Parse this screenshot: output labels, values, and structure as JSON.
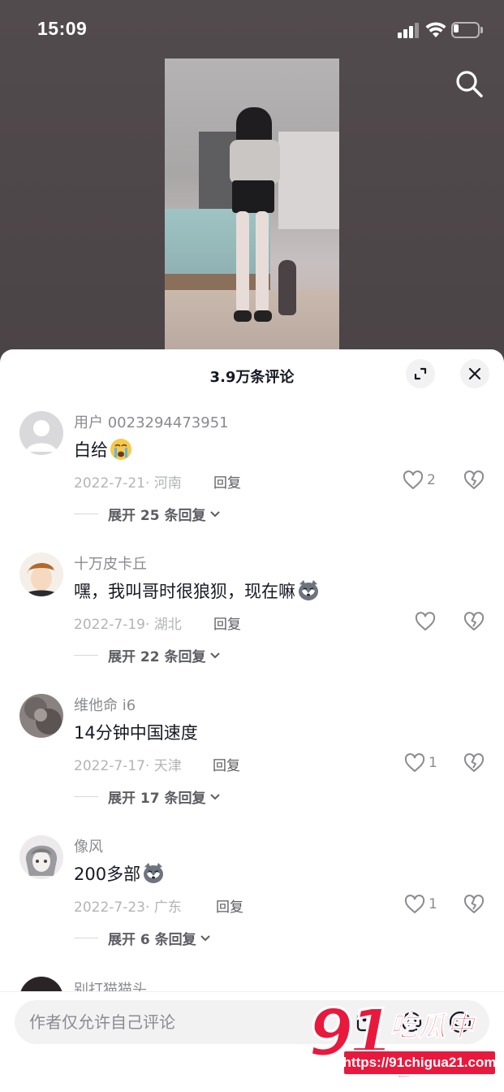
{
  "status_bar": {
    "time": "15:09",
    "battery_level": 0.2
  },
  "sheet": {
    "title": "3.9万条评论"
  },
  "comments": [
    {
      "user": "用户 0023294473951",
      "text": "白给",
      "emoji": "crying-face-emoji",
      "date": "2022-7-21· 河南",
      "reply": "回复",
      "likes": "2",
      "expand": "展开 25 条回复"
    },
    {
      "user": "十万皮卡丘",
      "text": "嘿，我叫哥时很狼狈，现在嘛",
      "emoji": "husky-emoji",
      "date": "2022-7-19· 湖北",
      "reply": "回复",
      "likes": "",
      "expand": "展开 22 条回复"
    },
    {
      "user": "维他命 i6",
      "text": "14分钟中国速度",
      "emoji": "",
      "date": "2022-7-17· 天津",
      "reply": "回复",
      "likes": "1",
      "expand": "展开 17 条回复"
    },
    {
      "user": "像风",
      "text": "200多部",
      "emoji": "husky-emoji",
      "date": "2022-7-23· 广东",
      "reply": "回复",
      "likes": "1",
      "expand": "展开 6 条回复"
    },
    {
      "user": "别打猫猫头"
    }
  ],
  "input": {
    "placeholder": "作者仅允许自己评论"
  },
  "watermark": {
    "logo": "91",
    "name": "吃瓜中心",
    "url": "https://91chigua21.com"
  },
  "colors": {
    "accent": "#e8193c",
    "text": "#161823",
    "muted": "#8a8b91"
  }
}
